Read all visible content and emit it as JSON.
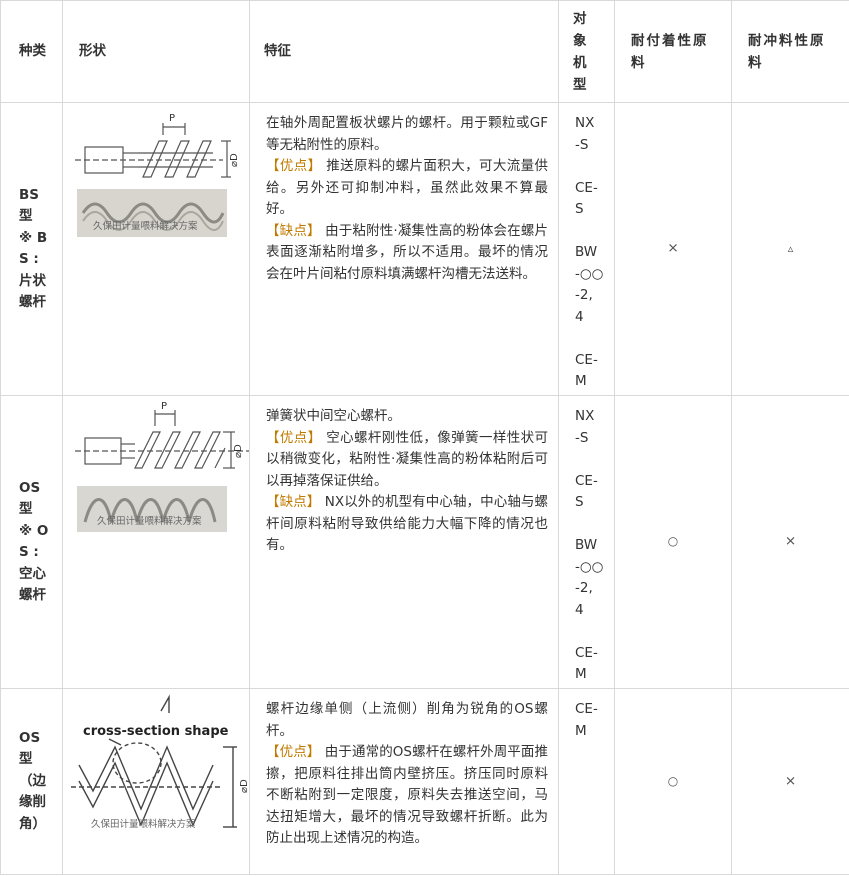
{
  "headers": {
    "type": "种类",
    "shape": "形状",
    "feature": "特征",
    "model_lines": [
      "对",
      "象",
      "机",
      "型"
    ],
    "adhesion_lines": [
      "耐付着性原",
      "料"
    ],
    "flush_lines": [
      "耐冲料性原",
      "料"
    ]
  },
  "rows": [
    {
      "type_lines": [
        "BS",
        "型",
        "※ B",
        "S :",
        "片状",
        "螺杆"
      ],
      "feature_intro": "在轴外周配置板状螺片的螺杆。用于颗粒或GF等无粘附性的原料。",
      "pros_label": "【优点】",
      "pros_text": " 推送原料的螺片面积大，可大流量供给。另外还可抑制冲料，虽然此效果不算最好。",
      "cons_label": "【缺点】",
      "cons_text": " 由于粘附性·凝集性高的粉体会在螺片表面逐渐粘附增多，所以不适用。最坏的情况会在叶片间粘付原料填满螺杆沟槽无法送料。",
      "model_lines": [
        "NX",
        "-S",
        "",
        "CE-",
        "S",
        "",
        "BW",
        "-○○",
        "-2,",
        "4",
        "",
        "CE-",
        "M"
      ],
      "adhesion": "×",
      "flush": "▵",
      "shape_labels": {
        "pitch": "P",
        "dia": "⌀D",
        "watermark": "久保田计量喂料解决方案"
      }
    },
    {
      "type_lines": [
        "OS",
        "型",
        "※ O",
        "S :",
        "空心",
        "螺杆"
      ],
      "feature_intro": "弹簧状中间空心螺杆。",
      "pros_label": "【优点】",
      "pros_text": " 空心螺杆刚性低，像弹簧一样性状可以稍微变化，粘附性·凝集性高的粉体粘附后可以再掉落保证供给。",
      "cons_label": "【缺点】",
      "cons_text": " NX以外的机型有中心轴，中心轴与螺杆间原料粘附导致供给能力大幅下降的情况也有。",
      "model_lines": [
        "NX",
        "-S",
        "",
        "CE-",
        "S",
        "",
        "BW",
        "-○○",
        "-2,",
        "4",
        "",
        "CE-",
        "M"
      ],
      "adhesion": "○",
      "flush": "×",
      "shape_labels": {
        "pitch": "P",
        "dia": "⌀D",
        "watermark": "久保田计量喂料解决方案"
      }
    },
    {
      "type_lines": [
        "OS",
        "型",
        "（边",
        "缘削",
        "角）"
      ],
      "feature_intro": "螺杆边缘单侧（上流侧）削角为锐角的OS螺杆。",
      "pros_label": "【优点】",
      "pros_text": " 由于通常的OS螺杆在螺杆外周平面推擦，把原料往排出筒内壁挤压。挤压同时原料不断粘附到一定限度，原料失去推送空间，马达扭矩增大，最坏的情况导致螺杆折断。此为防止出现上述情况的构造。",
      "model_lines": [
        "CE-",
        "M"
      ],
      "adhesion": "○",
      "flush": "×",
      "shape_labels": {
        "cross_section": "cross-section shape",
        "dia": "⌀D",
        "watermark": "久保田计量喂料解决方案"
      }
    }
  ]
}
